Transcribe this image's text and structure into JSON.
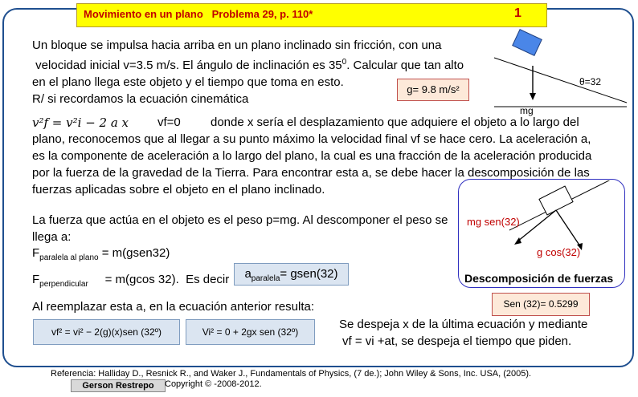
{
  "header": {
    "title": "Movimiento en un plano   Problema 29, p. 110*",
    "number": "1"
  },
  "intro": {
    "line1": "Un bloque se impulsa hacia arriba en un plano inclinado sin fricción, con una",
    "line2": "velocidad inicial v=3.5 m/s. El ángulo de inclinación es 35",
    "line2_sup": "0",
    "line2_end": ". Calcular que tan alto",
    "line3": "en el plano llega este objeto y el tiempo que toma en esto.",
    "line4": "R/ si recordamos la ecuación cinemática"
  },
  "gravity_box": "g= 9.8  m/s²",
  "diagram1": {
    "angle": "θ=32",
    "weight": "mg"
  },
  "equation": {
    "formula": "v²f = v²i − 2 a x",
    "vf_zero": "vf=0"
  },
  "explanation": {
    "line1": "donde x sería el desplazamiento que adquiere el objeto a lo largo del",
    "line2": "plano, reconocemos que al llegar a su punto máximo la velocidad final vf se hace cero. La aceleración a,",
    "line3": "es la componente de aceleración a lo largo del plano, la cual es una fracción de la aceleración producida",
    "line4": "por la fuerza de la gravedad de la Tierra. Para encontrar esta a, se debe hacer la descomposición de las",
    "line5": "fuerzas aplicadas sobre el objeto en el plano inclinado."
  },
  "forces": {
    "line1": "La fuerza que actúa en el objeto es el peso p=mg. Al descomponer el peso se",
    "line2": "llega a:",
    "parallel_label": "F",
    "parallel_sub": "paralela al plano",
    "parallel_value": " = m(gsen32)",
    "perp_label": "F",
    "perp_sub": "perpendicular",
    "perp_value": "     = m(gcos 32).  Es decir",
    "a_box_label": "a",
    "a_box_sub": "paralela",
    "a_box_value": "= gsen(32)"
  },
  "diagram2": {
    "mg_sen": "mg sen(32)",
    "g_cos": "g cos(32)",
    "caption": "Descomposición de fuerzas"
  },
  "sen_box": "Sen (32)= 0.5299",
  "replace_line": "Al reemplazar esta a, en la ecuación anterior resulta:",
  "eq_box1": "vf² = vi² − 2(g)(x)sen (32º)",
  "eq_box2": "Vi² = 0 + 2gx  sen (32º)",
  "conclusion": {
    "line1": "Se despeja x de la última ecuación y mediante",
    "line2": "vf = vi +at, se despeja el tiempo que piden."
  },
  "footer": {
    "reference": "Referencia: Halliday D., Resnick R.,  and Waker J., Fundamentals of Physics, (7 de.); John Wiley & Sons, Inc.  USA, (2005).",
    "author": "Gerson Restrepo",
    "copyright": "Copyright © -2008-2012."
  }
}
